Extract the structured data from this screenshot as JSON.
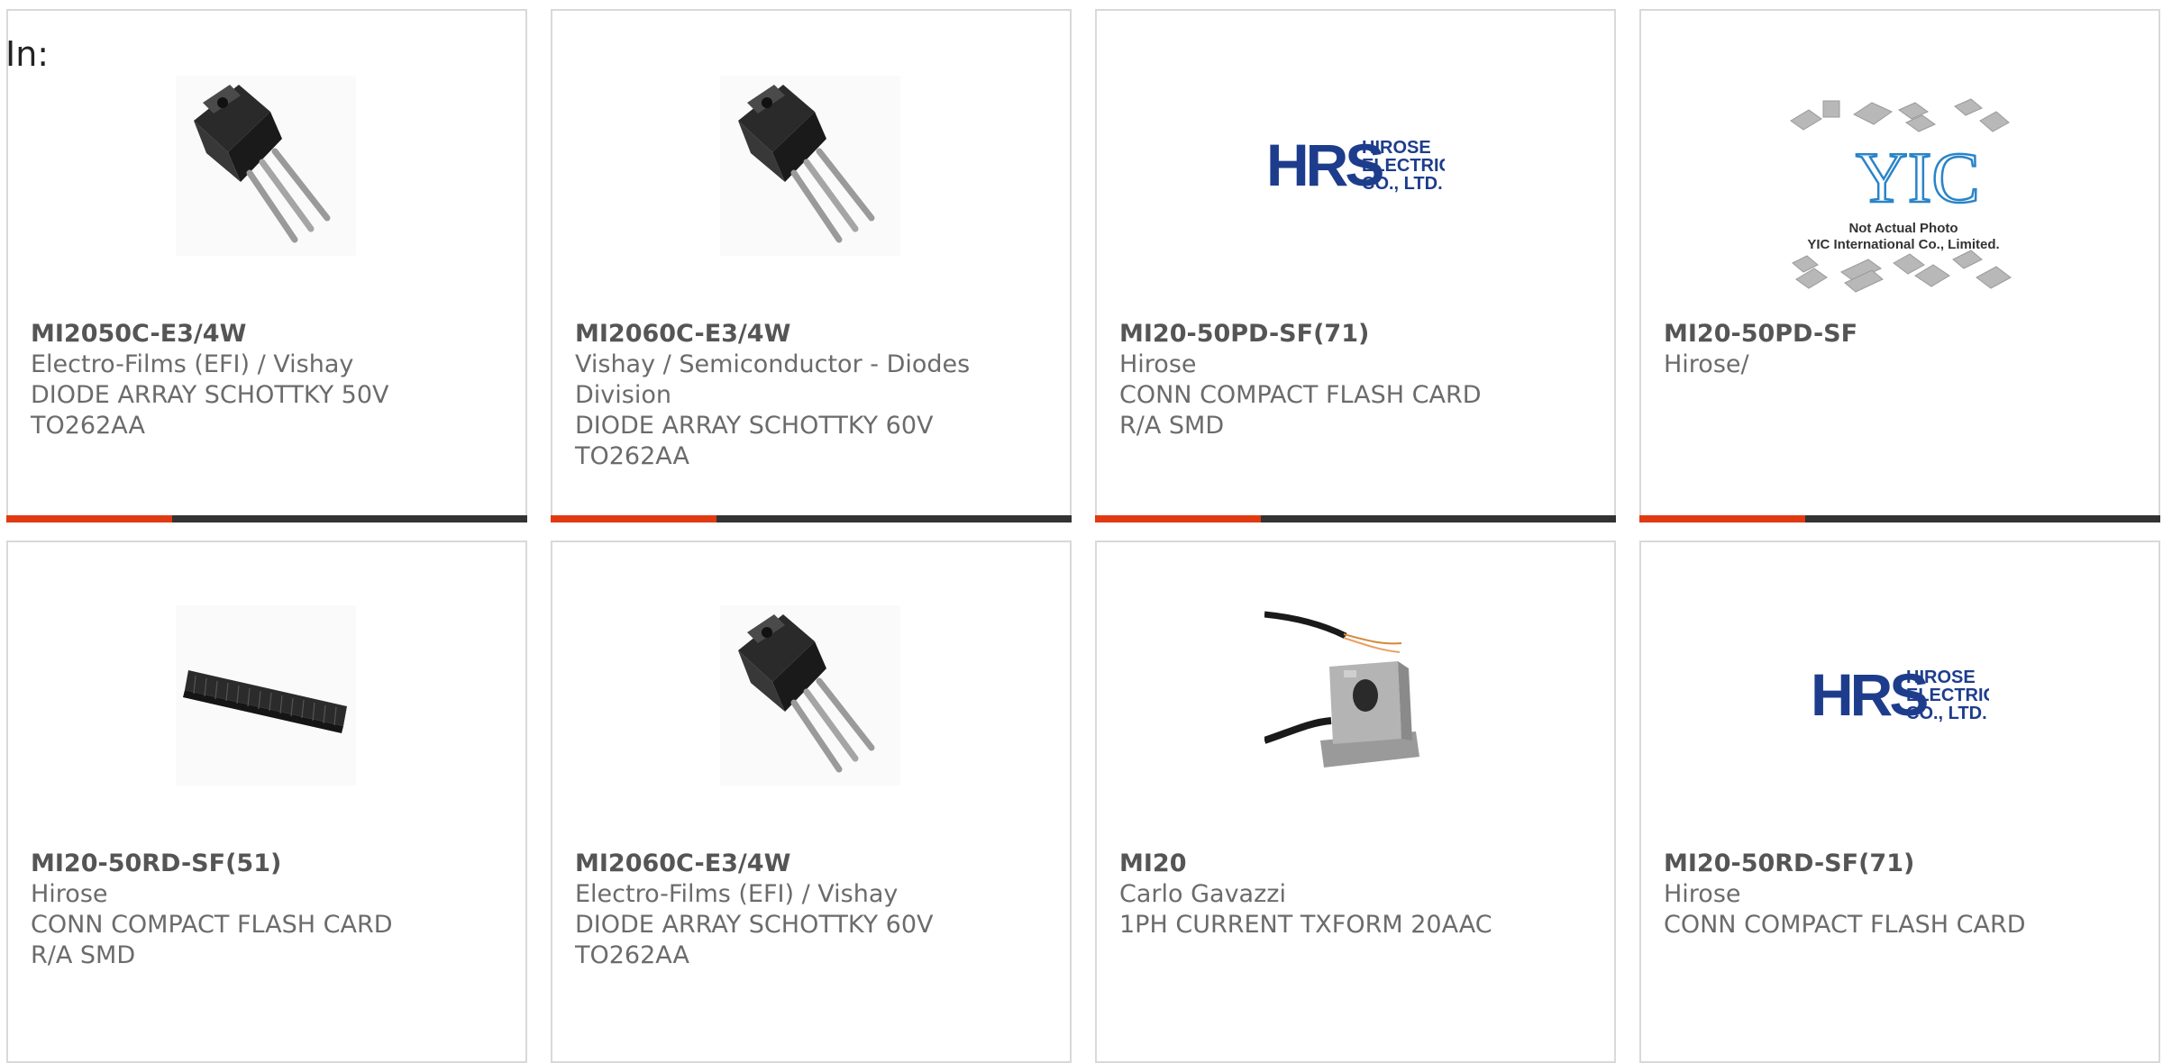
{
  "filter": {
    "label": "In:"
  },
  "colors": {
    "accent": "#e03a12",
    "bar": "#333333",
    "border": "#d9d9d9",
    "text": "#6b6b6b",
    "hrs_blue": "#1d3d8c",
    "yic_blue": "#2a84c8"
  },
  "products": [
    {
      "part": "MI2050C-E3/4W",
      "manufacturer": "Electro-Films (EFI) / Vishay",
      "description_lines": [
        "DIODE ARRAY SCHOTTKY 50V",
        "TO262AA"
      ],
      "image": "to262-transistor-image"
    },
    {
      "part": "MI2060C-E3/4W",
      "manufacturer_lines": [
        "Vishay / Semiconductor - Diodes",
        "Division"
      ],
      "description_lines": [
        "DIODE ARRAY SCHOTTKY 60V",
        "TO262AA"
      ],
      "image": "to262-transistor-image"
    },
    {
      "part": "MI20-50PD-SF(71)",
      "manufacturer": "Hirose",
      "description_lines": [
        "CONN COMPACT FLASH CARD",
        "R/A SMD"
      ],
      "image": "hirose-logo",
      "logo_text": {
        "mark": "HRS",
        "line1": "HIROSE",
        "line2": "ELECTRIC",
        "line3": "CO., LTD."
      }
    },
    {
      "part": "MI20-50PD-SF",
      "manufacturer": "Hirose/",
      "description_lines": [],
      "image": "yic-placeholder",
      "logo_text": {
        "mark": "YIC",
        "caption1": "Not Actual Photo",
        "caption2": "YIC International Co., Limited."
      }
    },
    {
      "part": "MI20-50RD-SF(51)",
      "manufacturer": "Hirose",
      "description_lines": [
        "CONN COMPACT FLASH CARD",
        "R/A SMD"
      ],
      "image": "connector-strip-image"
    },
    {
      "part": "MI2060C-E3/4W",
      "manufacturer": "Electro-Films (EFI) / Vishay",
      "description_lines": [
        "DIODE ARRAY SCHOTTKY 60V",
        "TO262AA"
      ],
      "image": "to262-transistor-image"
    },
    {
      "part": "MI20",
      "manufacturer": "Carlo Gavazzi",
      "description_lines": [
        "1PH CURRENT TXFORM 20AAC"
      ],
      "image": "current-transformer-image"
    },
    {
      "part": "MI20-50RD-SF(71)",
      "manufacturer": "Hirose",
      "description_lines": [
        "CONN COMPACT FLASH CARD"
      ],
      "image": "hirose-logo",
      "logo_text": {
        "mark": "HRS",
        "line1": "HIROSE",
        "line2": "ELECTRIC",
        "line3": "CO., LTD."
      }
    }
  ]
}
